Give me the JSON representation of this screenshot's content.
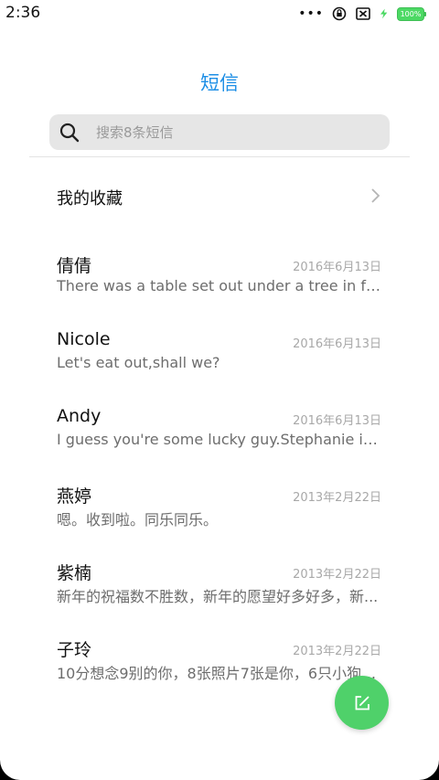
{
  "status_bar": {
    "time": "2:36",
    "more_indicator": "•••",
    "battery_label": "100%",
    "icons": [
      "rotation-lock-icon",
      "sim-off-icon",
      "charging-icon",
      "battery-icon"
    ]
  },
  "header": {
    "title": "短信"
  },
  "search": {
    "placeholder": "搜索8条短信"
  },
  "favorites": {
    "label": "我的收藏"
  },
  "conversations": [
    {
      "name": "倩倩",
      "date": "2016年6月13日",
      "snippet": "There was a table set out under a tree in front..."
    },
    {
      "name": "Nicole",
      "date": "2016年6月13日",
      "snippet": "Let's eat out,shall we?"
    },
    {
      "name": "Andy",
      "date": "2016年6月13日",
      "snippet": "I guess you're some lucky guy.Stephanie is a..."
    },
    {
      "name": "燕婷",
      "date": "2013年2月22日",
      "snippet": "嗯。收到啦。同乐同乐。"
    },
    {
      "name": "紫楠",
      "date": "2013年2月22日",
      "snippet": "新年的祝福数不胜数，新年的愿望好多好多，新..."
    },
    {
      "name": "子玲",
      "date": "2013年2月22日",
      "snippet": "10分想念9别的你，8张照片7张是你，6只小狗5只..."
    }
  ],
  "colors": {
    "accent": "#1e8fe6",
    "fab": "#4fd16a",
    "battery": "#4cd964"
  }
}
